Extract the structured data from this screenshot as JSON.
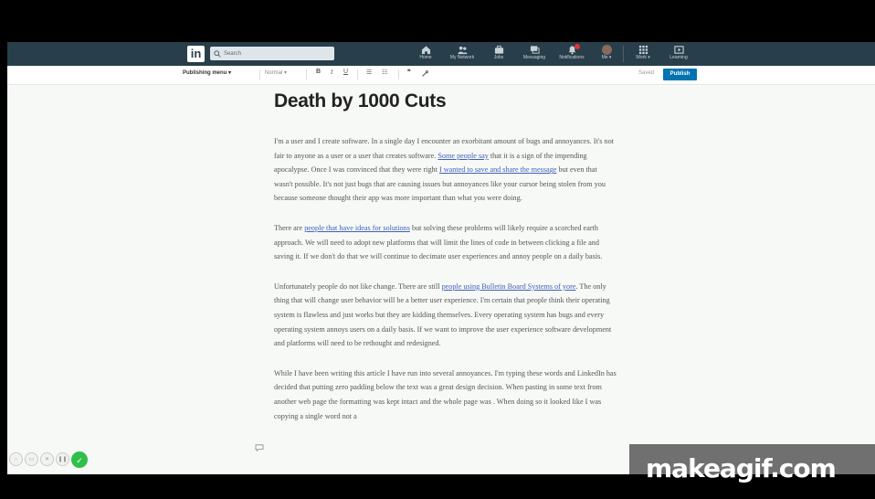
{
  "nav": {
    "logo": "in",
    "search_placeholder": "Search",
    "items": [
      {
        "label": "Home",
        "icon": "home-icon"
      },
      {
        "label": "My Network",
        "icon": "network-icon"
      },
      {
        "label": "Jobs",
        "icon": "jobs-icon"
      },
      {
        "label": "Messaging",
        "icon": "messaging-icon"
      },
      {
        "label": "Notifications",
        "icon": "bell-icon"
      },
      {
        "label": "Me ▾",
        "icon": "avatar"
      },
      {
        "label": "Work ▾",
        "icon": "grid-icon"
      },
      {
        "label": "Learning",
        "icon": "learning-icon"
      }
    ]
  },
  "toolbar": {
    "publishing_menu": "Publishing menu ▾",
    "style_select": "Normal ▾",
    "bold": "B",
    "italic": "I",
    "underline": "U",
    "bullet_list": "☰",
    "number_list": "☷",
    "quote": "❞",
    "link": "🔗",
    "saved": "Saved",
    "publish": "Publish"
  },
  "article": {
    "title": "Death by 1000 Cuts",
    "p1": {
      "t1": "I'm a user and I create software. In a single day I encounter an exorbitant amount of bugs and annoyances. It's not fair to anyone as a user or a user that creates software. ",
      "l1": "Some people say",
      "t2": " that it is a sign of the impending apocalypse. Once I was convinced that they were right ",
      "l2": "I wanted to save and share the message",
      "t3": " but even that wasn't possible. It's not just bugs that are causing issues but annoyances like your cursor being stolen from you because someone thought their app was more important than what you were doing."
    },
    "p2": {
      "t1": "There are ",
      "l1": "people that have ideas for solutions",
      "t2": " but solving these problems will likely require a scorched earth approach. We will need to adopt new platforms that will limit the lines of code in between clicking a file and saving it. If we don't do that we will continue to decimate user experiences and annoy people on a daily basis."
    },
    "p3": {
      "t1": "Unfortunately people do not like change. There are still ",
      "l1": "people using Bulletin Board Systems of yore",
      "t2": ". The only thing that will change user behavior will be a better user experience. I'm certain that people think their operating system is flawless and just works but they are kidding themselves. Every operating system has bugs and every operating system annoys users on a daily basis. If we want to improve the user experience software development and platforms will need to be rethought and redesigned."
    },
    "p4": {
      "t1": "While I have been writing this article I have run into several annoyances. I'm typing these words and LinkedIn has decided that putting zero padding below the text was a great design decision. When pasting in some text from another web page the formatting was kept intact and the whole page was . When doing so it looked like I was copying a single word not a"
    }
  },
  "watermark": "makeagif.com",
  "colors": {
    "nav_bg": "#283e4a",
    "publish_bg": "#0073b1",
    "link": "#4060b8",
    "ok_green": "#2fbf4a"
  }
}
